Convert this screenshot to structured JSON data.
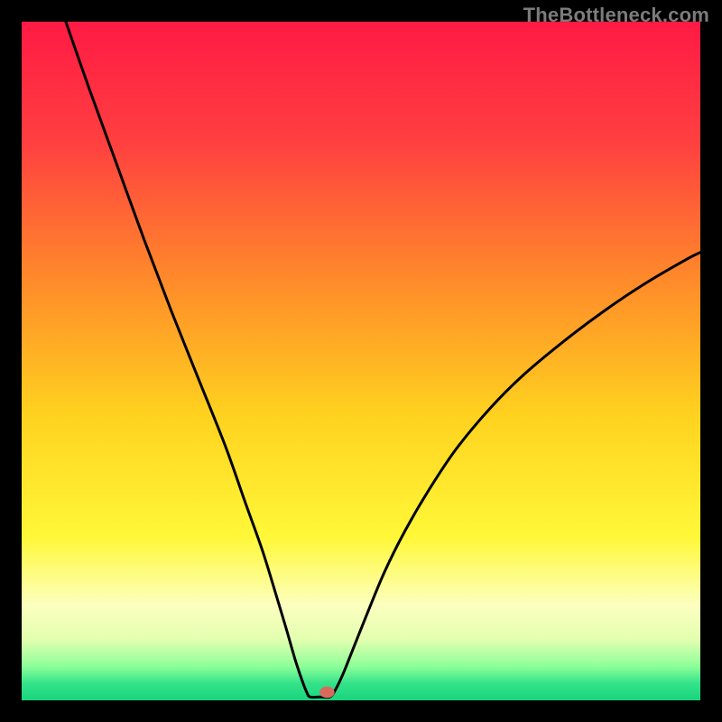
{
  "watermark": "TheBottleneck.com",
  "chart_data": {
    "type": "line",
    "title": "",
    "xlabel": "",
    "ylabel": "",
    "xlim": [
      0,
      100
    ],
    "ylim": [
      0,
      100
    ],
    "grid": false,
    "legend": false,
    "background_gradient_stops": [
      {
        "offset": 0.0,
        "color": "#ff1a44"
      },
      {
        "offset": 0.18,
        "color": "#ff4040"
      },
      {
        "offset": 0.38,
        "color": "#ff8a2a"
      },
      {
        "offset": 0.58,
        "color": "#ffd21f"
      },
      {
        "offset": 0.76,
        "color": "#fff838"
      },
      {
        "offset": 0.86,
        "color": "#fcffbf"
      },
      {
        "offset": 0.91,
        "color": "#e3ffb0"
      },
      {
        "offset": 0.95,
        "color": "#8dff99"
      },
      {
        "offset": 0.975,
        "color": "#34e38a"
      },
      {
        "offset": 1.0,
        "color": "#19d47d"
      }
    ],
    "curve_points": [
      {
        "x": 6.5,
        "y": 100.0
      },
      {
        "x": 10.0,
        "y": 90.0
      },
      {
        "x": 14.0,
        "y": 79.0
      },
      {
        "x": 18.0,
        "y": 68.0
      },
      {
        "x": 22.0,
        "y": 57.5
      },
      {
        "x": 26.0,
        "y": 47.5
      },
      {
        "x": 30.0,
        "y": 37.5
      },
      {
        "x": 33.0,
        "y": 29.0
      },
      {
        "x": 35.5,
        "y": 22.0
      },
      {
        "x": 37.5,
        "y": 15.5
      },
      {
        "x": 39.0,
        "y": 10.5
      },
      {
        "x": 40.3,
        "y": 6.0
      },
      {
        "x": 41.3,
        "y": 3.0
      },
      {
        "x": 42.0,
        "y": 1.2
      },
      {
        "x": 42.5,
        "y": 0.5
      },
      {
        "x": 44.0,
        "y": 0.5
      },
      {
        "x": 45.4,
        "y": 0.5
      },
      {
        "x": 46.2,
        "y": 1.5
      },
      {
        "x": 47.4,
        "y": 4.0
      },
      {
        "x": 49.0,
        "y": 8.0
      },
      {
        "x": 51.0,
        "y": 13.0
      },
      {
        "x": 53.5,
        "y": 19.0
      },
      {
        "x": 56.5,
        "y": 25.0
      },
      {
        "x": 60.0,
        "y": 31.0
      },
      {
        "x": 64.0,
        "y": 37.0
      },
      {
        "x": 69.0,
        "y": 43.0
      },
      {
        "x": 74.0,
        "y": 48.0
      },
      {
        "x": 80.0,
        "y": 53.0
      },
      {
        "x": 86.0,
        "y": 57.5
      },
      {
        "x": 92.0,
        "y": 61.5
      },
      {
        "x": 98.0,
        "y": 65.0
      },
      {
        "x": 100.0,
        "y": 66.0
      }
    ],
    "marker": {
      "x": 45.0,
      "y": 1.2,
      "rx": 1.1,
      "ry": 0.85,
      "color": "#d86a5d"
    },
    "curve_stroke": "#000000",
    "curve_width": 3
  }
}
